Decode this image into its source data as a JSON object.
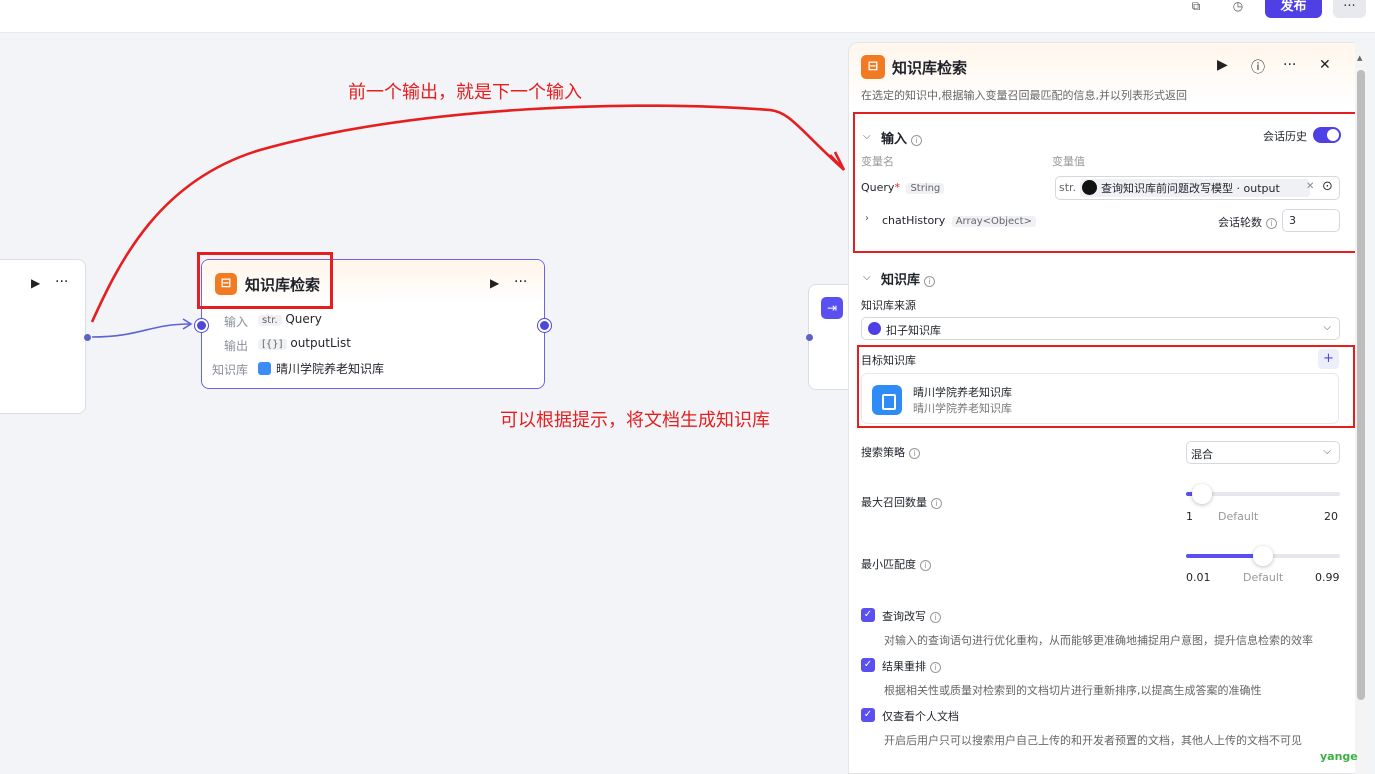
{
  "topbar": {
    "publish_label": "发布",
    "more_label": "···"
  },
  "annotations": {
    "top": "前一个输出，就是下一个输入",
    "middle": "可以根据提示，将文档生成知识库"
  },
  "main_node": {
    "title": "知识库检索",
    "rows": [
      {
        "label": "输入",
        "tag": "str.",
        "value": "Query"
      },
      {
        "label": "输出",
        "tag": "[{}]",
        "value": "outputList"
      },
      {
        "label": "知识库",
        "value": "晴川学院养老知识库"
      }
    ]
  },
  "panel": {
    "title": "知识库检索",
    "description": "在选定的知识中,根据输入变量召回最匹配的信息,并以列表形式返回",
    "input": {
      "title": "输入",
      "history_label": "会话历史",
      "history_on": true,
      "var_name_header": "变量名",
      "var_value_header": "变量值",
      "query": {
        "name": "Query",
        "required": "*",
        "type": "String",
        "value_tag": "str.",
        "value": "查询知识库前问题改写模型 · output"
      },
      "chat_history": {
        "name": "chatHistory",
        "type": "Array<Object>",
        "rounds_label": "会话轮数",
        "rounds_value": "3"
      }
    },
    "knowledge": {
      "title": "知识库",
      "source_label": "知识库来源",
      "source_value": "扣子知识库",
      "target_label": "目标知识库",
      "add_label": "+",
      "kb_name": "晴川学院养老知识库",
      "kb_subtitle": "晴川学院养老知识库"
    },
    "search_strategy": {
      "label": "搜索策略",
      "value": "混合"
    },
    "max_recall": {
      "label": "最大召回数量",
      "min": "1",
      "default_label": "Default",
      "max": "20",
      "value": 3
    },
    "min_match": {
      "label": "最小匹配度",
      "min": "0.01",
      "default_label": "Default",
      "max": "0.99",
      "value": 0.5
    },
    "options": [
      {
        "label": "查询改写",
        "checked": true,
        "desc": "对输入的查询语句进行优化重构，从而能够更准确地捕捉用户意图，提升信息检索的效率"
      },
      {
        "label": "结果重排",
        "checked": true,
        "desc": "根据相关性或质量对检索到的文档切片进行重新排序,以提高生成答案的准确性"
      },
      {
        "label": "仅查看个人文档",
        "checked": true,
        "desc": "开启后用户只可以搜索用户自己上传的和开发者预置的文档，其他人上传的文档不可见"
      }
    ]
  },
  "watermark": "yange",
  "colors": {
    "accent": "#4e40e5",
    "annotation_red": "#e51f1f",
    "kb_icon": "#f27a22"
  }
}
